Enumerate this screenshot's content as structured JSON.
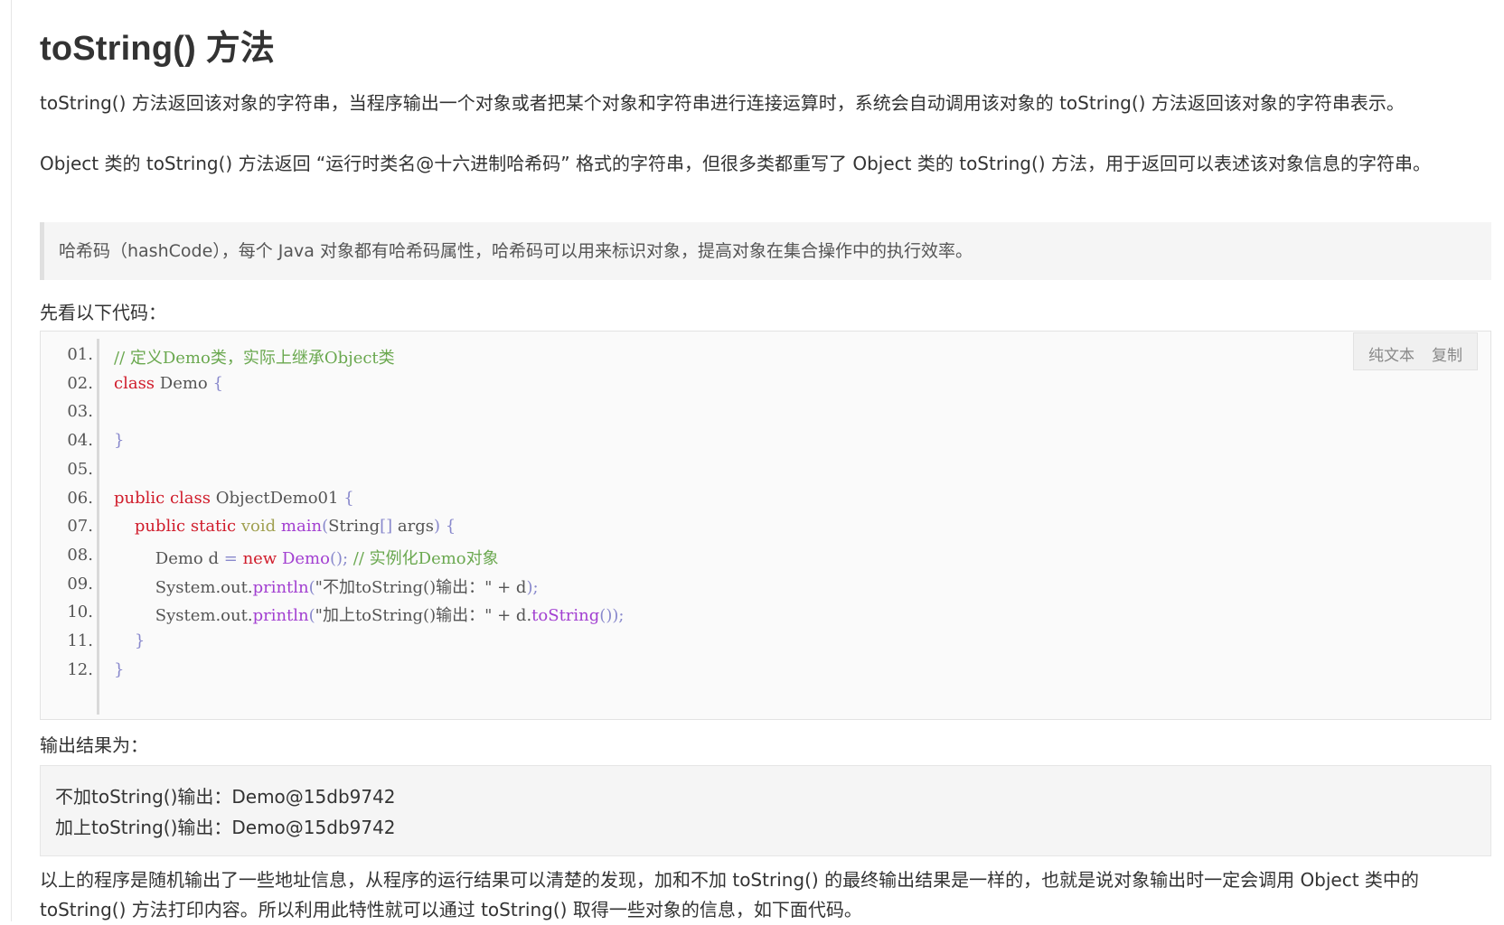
{
  "heading": "toString() 方法",
  "paragraph_1": "toString() 方法返回该对象的字符串，当程序输出一个对象或者把某个对象和字符串进行连接运算时，系统会自动调用该对象的 toString() 方法返回该对象的字符串表示。",
  "paragraph_2": "Object 类的 toString() 方法返回 “运行时类名@十六进制哈希码” 格式的字符串，但很多类都重写了 Object 类的 toString() 方法，用于返回可以表述该对象信息的字符串。",
  "note": "哈希码（hashCode），每个 Java 对象都有哈希码属性，哈希码可以用来标识对象，提高对象在集合操作中的执行效率。",
  "code_intro": "先看以下代码：",
  "code_tools": {
    "plain_text": "纯文本",
    "copy": "复制"
  },
  "code_lines": [
    {
      "num": "01.",
      "parts": [
        {
          "t": "// 定义Demo类，实际上继承Object类",
          "c": "cm"
        }
      ]
    },
    {
      "num": "02.",
      "parts": [
        {
          "t": "class",
          "c": "kw"
        },
        {
          "t": " Demo ",
          "c": ""
        },
        {
          "t": "{",
          "c": "br"
        }
      ]
    },
    {
      "num": "03.",
      "parts": []
    },
    {
      "num": "04.",
      "parts": [
        {
          "t": "}",
          "c": "br"
        }
      ]
    },
    {
      "num": "05.",
      "parts": []
    },
    {
      "num": "06.",
      "parts": [
        {
          "t": "public",
          "c": "kw"
        },
        {
          "t": " ",
          "c": ""
        },
        {
          "t": "class",
          "c": "kw"
        },
        {
          "t": " ObjectDemo01 ",
          "c": ""
        },
        {
          "t": "{",
          "c": "br"
        }
      ]
    },
    {
      "num": "07.",
      "parts": [
        {
          "t": "    ",
          "c": ""
        },
        {
          "t": "public",
          "c": "kw"
        },
        {
          "t": " ",
          "c": ""
        },
        {
          "t": "static",
          "c": "kw"
        },
        {
          "t": " ",
          "c": ""
        },
        {
          "t": "void",
          "c": "ty"
        },
        {
          "t": " ",
          "c": ""
        },
        {
          "t": "main",
          "c": "fn"
        },
        {
          "t": "(",
          "c": "br"
        },
        {
          "t": "String",
          "c": ""
        },
        {
          "t": "[]",
          "c": "br"
        },
        {
          "t": " args",
          "c": ""
        },
        {
          "t": ")",
          "c": "br"
        },
        {
          "t": " ",
          "c": ""
        },
        {
          "t": "{",
          "c": "br"
        }
      ]
    },
    {
      "num": "08.",
      "parts": [
        {
          "t": "        Demo d ",
          "c": ""
        },
        {
          "t": "=",
          "c": "br"
        },
        {
          "t": " ",
          "c": ""
        },
        {
          "t": "new",
          "c": "kw"
        },
        {
          "t": " ",
          "c": ""
        },
        {
          "t": "Demo",
          "c": "fn"
        },
        {
          "t": "();",
          "c": "br"
        },
        {
          "t": " ",
          "c": ""
        },
        {
          "t": "// 实例化Demo对象",
          "c": "cm"
        }
      ]
    },
    {
      "num": "09.",
      "parts": [
        {
          "t": "        System.out.",
          "c": ""
        },
        {
          "t": "println",
          "c": "fn"
        },
        {
          "t": "(",
          "c": "br"
        },
        {
          "t": "\"不加toString()输出：\"",
          "c": ""
        },
        {
          "t": " + d",
          "c": ""
        },
        {
          "t": ");",
          "c": "br"
        }
      ]
    },
    {
      "num": "10.",
      "parts": [
        {
          "t": "        System.out.",
          "c": ""
        },
        {
          "t": "println",
          "c": "fn"
        },
        {
          "t": "(",
          "c": "br"
        },
        {
          "t": "\"加上toString()输出：\"",
          "c": ""
        },
        {
          "t": " + d.",
          "c": ""
        },
        {
          "t": "toString",
          "c": "fn"
        },
        {
          "t": "());",
          "c": "br"
        }
      ]
    },
    {
      "num": "11.",
      "parts": [
        {
          "t": "    ",
          "c": ""
        },
        {
          "t": "}",
          "c": "br"
        }
      ]
    },
    {
      "num": "12.",
      "parts": [
        {
          "t": "}",
          "c": "br"
        }
      ]
    }
  ],
  "output_intro": "输出结果为：",
  "output_lines": [
    "不加toString()输出：Demo@15db9742",
    "加上toString()输出：Demo@15db9742"
  ],
  "paragraph_3": "以上的程序是随机输出了一些地址信息，从程序的运行结果可以清楚的发现，加和不加 toString() 的最终输出结果是一样的，也就是说对象输出时一定会调用 Object 类中的 toString() 方法打印内容。所以利用此特性就可以通过 toString() 取得一些对象的信息，如下面代码。"
}
